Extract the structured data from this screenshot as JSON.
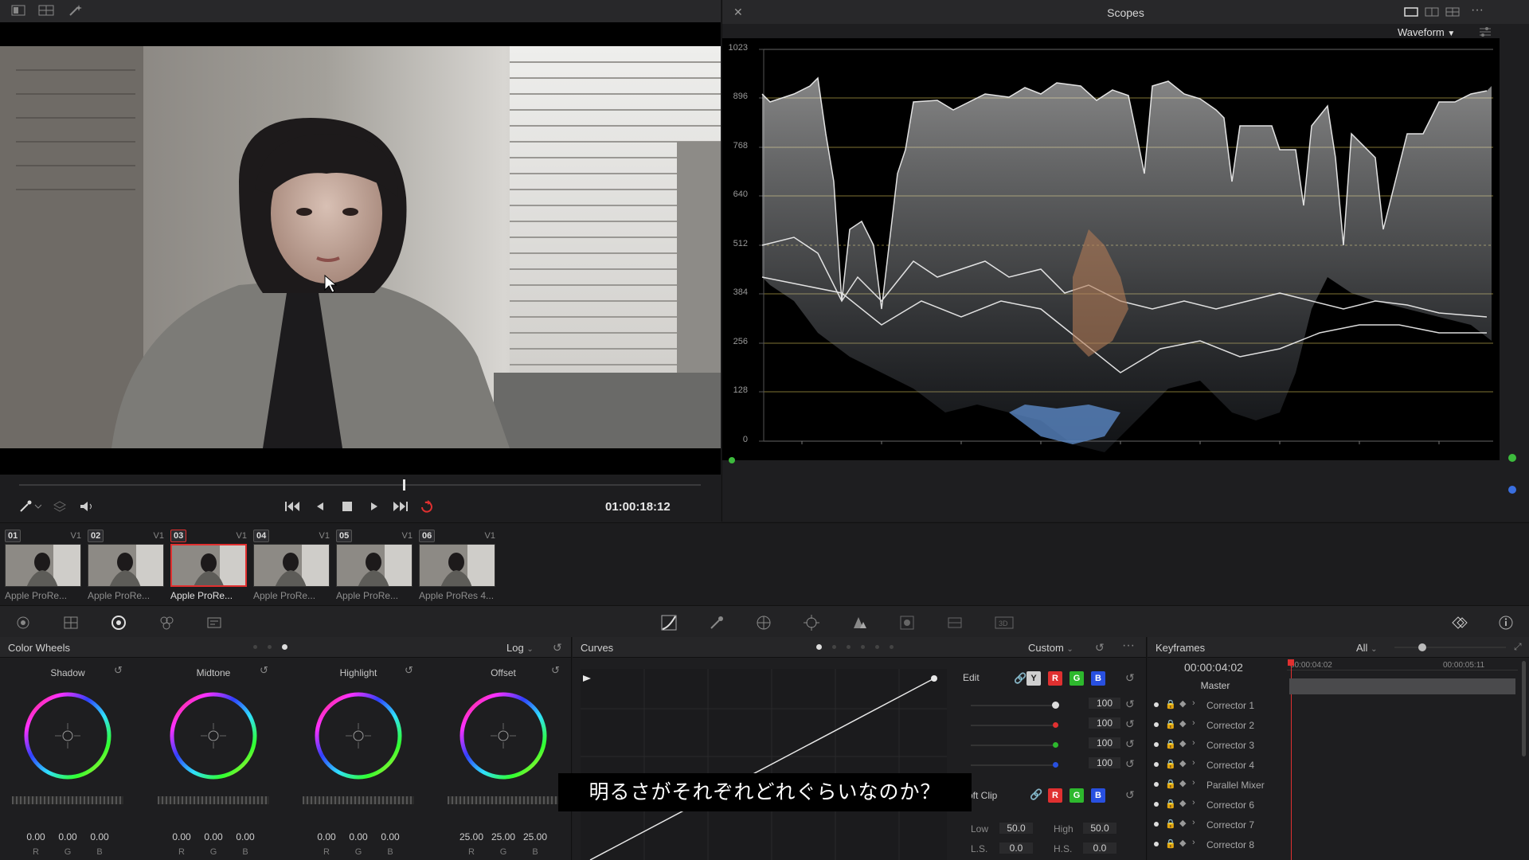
{
  "scopes": {
    "title": "Scopes",
    "mode": "Waveform",
    "scale_labels": [
      "1023",
      "896",
      "768",
      "640",
      "512",
      "384",
      "256",
      "128",
      "0"
    ]
  },
  "transport": {
    "timecode": "01:00:18:12"
  },
  "clips": [
    {
      "num": "01",
      "track": "V1",
      "name": "Apple ProRe...",
      "selected": false
    },
    {
      "num": "02",
      "track": "V1",
      "name": "Apple ProRe...",
      "selected": false
    },
    {
      "num": "03",
      "track": "V1",
      "name": "Apple ProRe...",
      "selected": true
    },
    {
      "num": "04",
      "track": "V1",
      "name": "Apple ProRe...",
      "selected": false
    },
    {
      "num": "05",
      "track": "V1",
      "name": "Apple ProRe...",
      "selected": false
    },
    {
      "num": "06",
      "track": "V1",
      "name": "Apple ProRes 4...",
      "selected": false
    }
  ],
  "color_wheels": {
    "title": "Color Wheels",
    "mode": "Log",
    "wheels": [
      {
        "label": "Shadow",
        "values": [
          "0.00",
          "0.00",
          "0.00"
        ]
      },
      {
        "label": "Midtone",
        "values": [
          "0.00",
          "0.00",
          "0.00"
        ]
      },
      {
        "label": "Highlight",
        "values": [
          "0.00",
          "0.00",
          "0.00"
        ]
      },
      {
        "label": "Offset",
        "values": [
          "25.00",
          "25.00",
          "25.00"
        ]
      }
    ],
    "channels": [
      "R",
      "G",
      "B"
    ]
  },
  "curves": {
    "title": "Curves",
    "mode": "Custom",
    "edit_label": "Edit",
    "channel_buttons": [
      "Y",
      "R",
      "G",
      "B"
    ],
    "edit_values": [
      "100",
      "100",
      "100",
      "100"
    ],
    "soft_clip_label": "oft Clip",
    "low_label": "Low",
    "low_value": "50.0",
    "high_label": "High",
    "high_value": "50.0",
    "ls_label": "L.S.",
    "ls_value": "0.0",
    "hs_label": "H.S.",
    "hs_value": "0.0"
  },
  "keyframes": {
    "title": "Keyframes",
    "filter": "All",
    "current_time": "00:00:04:02",
    "ruler_start": "00:00:04:02",
    "ruler_end": "00:00:05:11",
    "master": "Master",
    "rows": [
      "Corrector 1",
      "Corrector 2",
      "Corrector 3",
      "Corrector 4",
      "Parallel Mixer",
      "Corrector 6",
      "Corrector 7",
      "Corrector 8"
    ]
  },
  "subtitle": "明るさがそれぞれどれぐらいなのか？",
  "colors": {
    "accent_red": "#e03030",
    "accent_green": "#2db82d",
    "accent_blue": "#2850e0"
  }
}
